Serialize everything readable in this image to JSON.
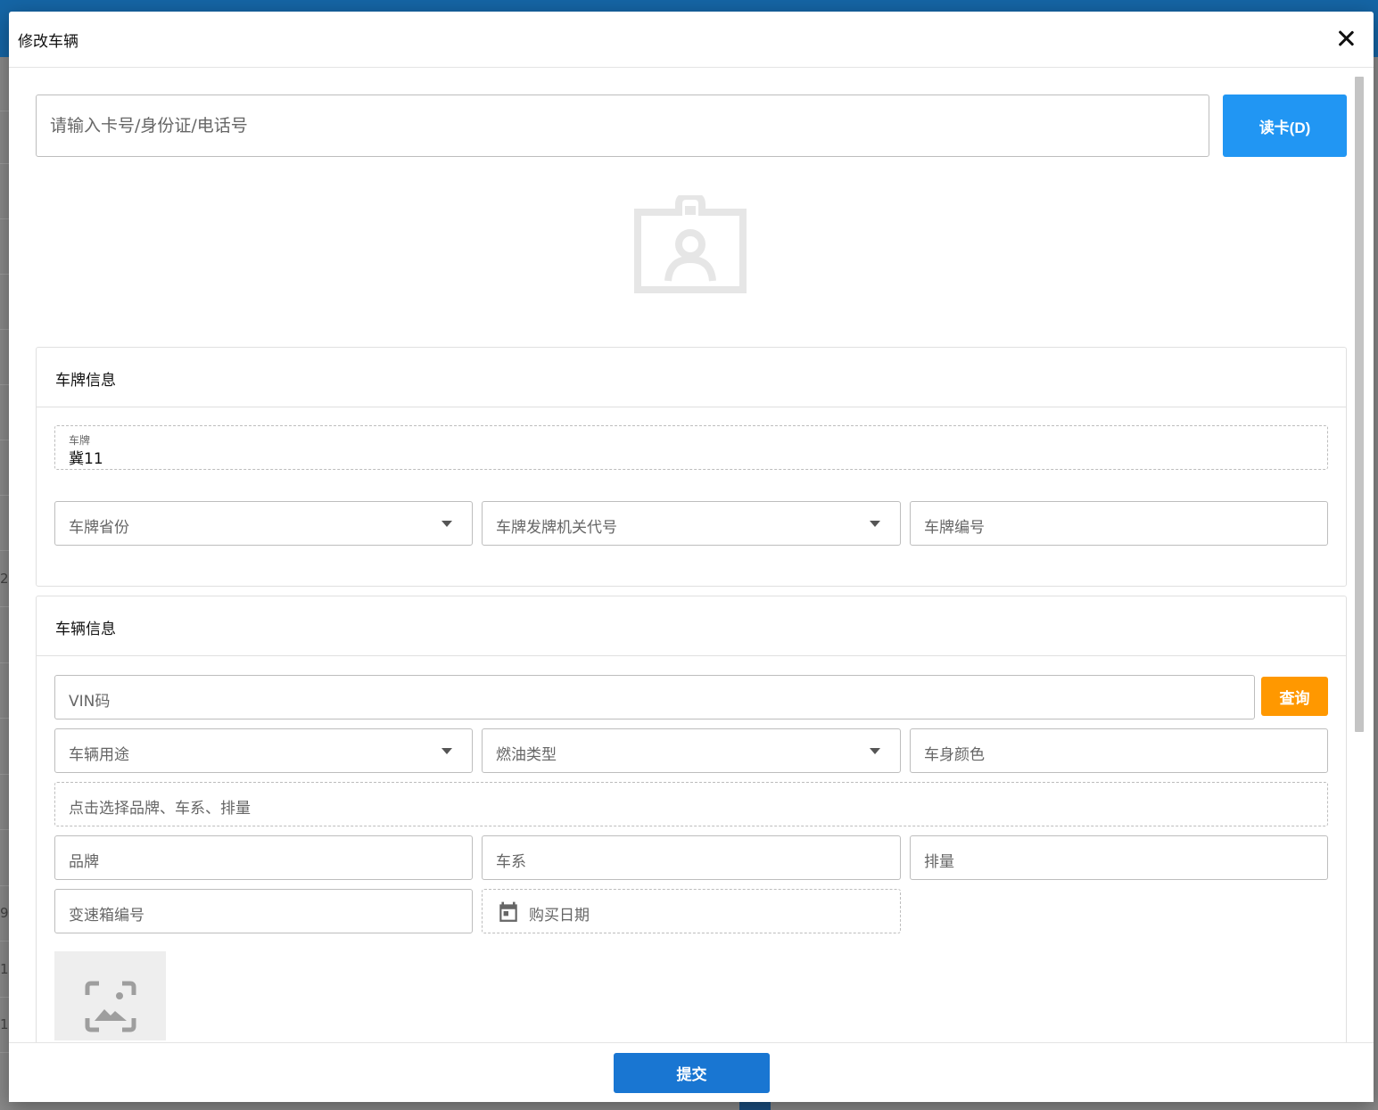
{
  "dialog": {
    "title": "修改车辆",
    "close_icon": "close-icon"
  },
  "search": {
    "placeholder": "请输入卡号/身份证/电话号",
    "read_card_label": "读卡(D)"
  },
  "plate_section": {
    "title": "车牌信息",
    "plate_label": "车牌",
    "plate_value": "冀11",
    "province_placeholder": "车牌省份",
    "authority_placeholder": "车牌发牌机关代号",
    "number_placeholder": "车牌编号"
  },
  "vehicle_section": {
    "title": "车辆信息",
    "vin_placeholder": "VIN码",
    "query_label": "查询",
    "usage_placeholder": "车辆用途",
    "fuel_placeholder": "燃油类型",
    "color_placeholder": "车身颜色",
    "brand_picker_placeholder": "点击选择品牌、车系、排量",
    "brand_placeholder": "品牌",
    "series_placeholder": "车系",
    "displacement_placeholder": "排量",
    "gearbox_placeholder": "变速箱编号",
    "purchase_date_placeholder": "购买日期"
  },
  "footer": {
    "submit_label": "提交"
  },
  "background": {
    "fragments": [
      "2",
      "9",
      "1",
      "1"
    ]
  },
  "colors": {
    "primary": "#2196f3",
    "submit": "#1976d2",
    "warning": "#ff9800",
    "topbar": "#1565a5"
  }
}
